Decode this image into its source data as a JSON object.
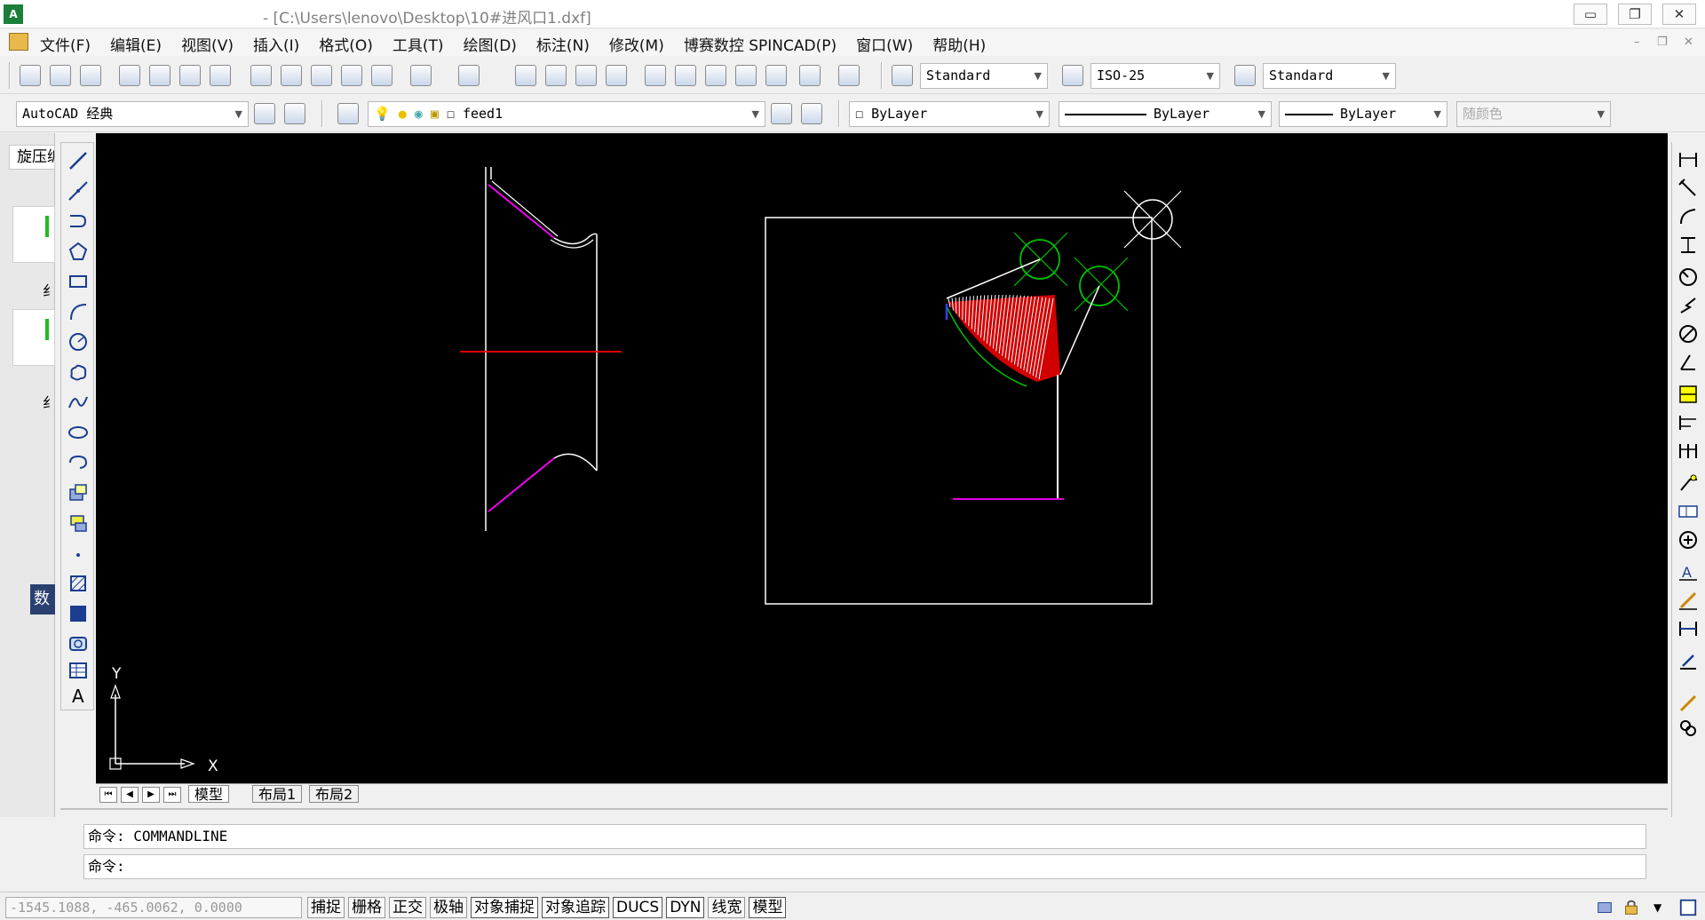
{
  "window": {
    "title": "- [C:\\Users\\lenovo\\Desktop\\10#进风口1.dxf]",
    "icon_text": "A",
    "minimize": "▭",
    "restore": "❐",
    "close": "✕"
  },
  "menu": {
    "items": [
      "文件(F)",
      "编辑(E)",
      "视图(V)",
      "插入(I)",
      "格式(O)",
      "工具(T)",
      "绘图(D)",
      "标注(N)",
      "修改(M)",
      "博赛数控 SPINCAD(P)",
      "窗口(W)",
      "帮助(H)"
    ],
    "mdi_min": "–",
    "mdi_restore": "❐",
    "mdi_close": "✕"
  },
  "toolbar": {
    "text_style": "Standard",
    "dim_style": "ISO-25",
    "table_style": "Standard",
    "workspace": "AutoCAD 经典",
    "layer": "feed1",
    "color": "ByLayer",
    "linetype": "ByLayer",
    "lineweight": "ByLayer",
    "plotstyle": "随颜色"
  },
  "palette": {
    "tab": "旋压编",
    "label_1": "纟",
    "label_2": "纟",
    "label_3": "数"
  },
  "canvas": {
    "ucs_x": "X",
    "ucs_y": "Y"
  },
  "layout_tabs": [
    "模型",
    "布局1",
    "布局2"
  ],
  "command": {
    "line1": "命令: COMMANDLINE",
    "line2": "命令:"
  },
  "status": {
    "coords": "-1545.1088, -465.0062, 0.0000",
    "toggles": [
      "捕捉",
      "栅格",
      "正交",
      "极轴",
      "对象捕捉",
      "对象追踪",
      "DUCS",
      "DYN",
      "线宽",
      "模型"
    ]
  },
  "colors": {
    "canvas_bg": "#000000",
    "geometry": "#ffffff",
    "axis_red": "#ff0000",
    "magenta": "#ff00ff",
    "green": "#00c000",
    "fill_red": "#d00000"
  }
}
